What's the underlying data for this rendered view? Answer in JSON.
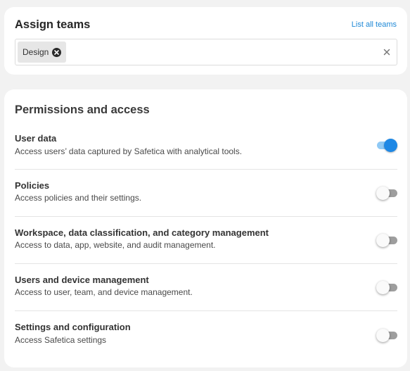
{
  "assign_teams": {
    "title": "Assign teams",
    "list_all_label": "List all teams",
    "selected_teams": [
      {
        "label": "Design"
      }
    ]
  },
  "permissions": {
    "title": "Permissions and access",
    "items": [
      {
        "title": "User data",
        "description": "Access users’ data captured by Safetica with analytical tools.",
        "enabled": true
      },
      {
        "title": "Policies",
        "description": "Access policies and their settings.",
        "enabled": false
      },
      {
        "title": "Workspace, data classification, and category management",
        "description": "Access to data, app, website, and audit management.",
        "enabled": false
      },
      {
        "title": "Users and device management",
        "description": "Access to user, team, and device management.",
        "enabled": false
      },
      {
        "title": "Settings and configuration",
        "description": "Access Safetica settings",
        "enabled": false
      }
    ]
  },
  "colors": {
    "toggle_on": "#1e88e5",
    "toggle_on_track": "#8fc9f5",
    "toggle_off_track": "#9e9e9e",
    "link": "#1e88d6"
  }
}
